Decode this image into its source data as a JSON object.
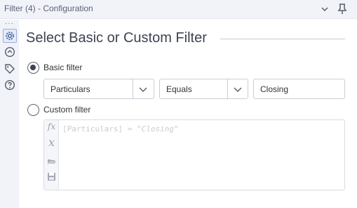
{
  "window": {
    "title": "Filter (4) - Configuration"
  },
  "rail": {
    "more": "···"
  },
  "main": {
    "heading": "Select Basic or Custom Filter",
    "basic": {
      "label": "Basic filter",
      "selected": true,
      "field": "Particulars",
      "operator": "Equals",
      "value": "Closing"
    },
    "custom": {
      "label": "Custom filter",
      "selected": false,
      "expression_field": "[Particulars]",
      "expression_op": " = ",
      "expression_value": "\"Closing\""
    }
  },
  "icons": {
    "collapse": "chevron-down-icon",
    "pin": "pin-icon",
    "configuration": "gear-icon",
    "annotation": "annotation-icon",
    "tag": "tag-icon",
    "help": "help-icon",
    "function": "function-icon",
    "variable": "variable-icon",
    "open": "folder-open-icon",
    "save": "save-icon"
  }
}
